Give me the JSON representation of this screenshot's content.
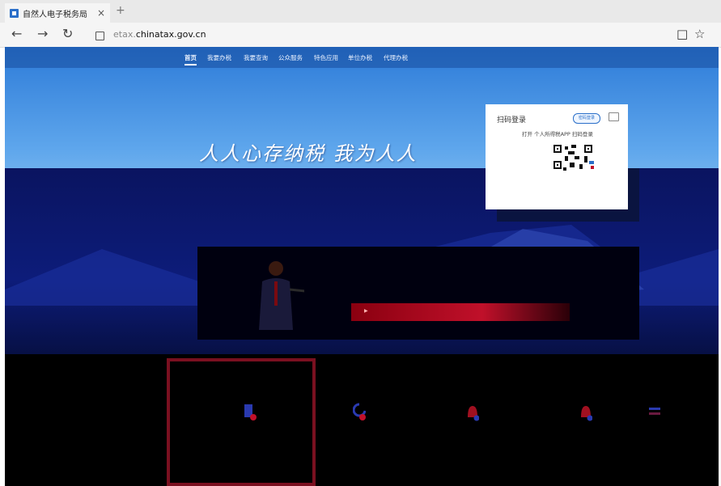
{
  "browser": {
    "tab_title": "自然人电子税务局",
    "tab_close": "×",
    "new_tab": "+",
    "url_prefix": "etax.",
    "url_domain": "chinatax.gov.cn",
    "back_icon": "←",
    "forward_icon": "→",
    "refresh_icon": "↻",
    "reader_icon": "□",
    "favorite_icon": "☆"
  },
  "nav": {
    "items": [
      "首页",
      "我要办税",
      "我要查询",
      "公众服务",
      "特色应用",
      "单位办税",
      "代理办税"
    ],
    "active_index": 0
  },
  "hero": {
    "slogan": "人人心存纳税 我为人人"
  },
  "login": {
    "title": "扫码登录",
    "mode_button": "密码登录",
    "hint": "打开 个人所得税APP 扫码登录"
  },
  "colors": {
    "accent": "#2a6fc9",
    "hero_blue": "#2d7bd8",
    "dark_band": "#0a1460",
    "card_border": "#7a1020"
  }
}
